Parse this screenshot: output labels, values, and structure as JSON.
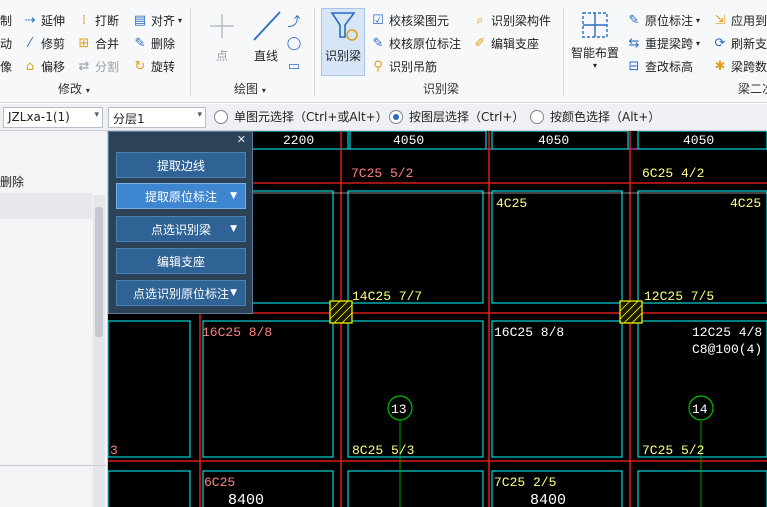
{
  "ribbon": {
    "modify": {
      "col1": [
        "制",
        "动",
        "像"
      ],
      "col2": [
        "延伸",
        "修剪",
        "偏移"
      ],
      "col3": [
        "打断",
        "合并",
        "分割"
      ],
      "col4": [
        "对齐",
        "删除",
        "旋转"
      ],
      "group_label": "修改"
    },
    "draw": {
      "point": "点",
      "line": "直线",
      "group_label": "绘图"
    },
    "identify_beam": {
      "big_button": "识别梁",
      "items": [
        "校核梁图元",
        "校核原位标注",
        "识别吊筋",
        "识别梁构件",
        "编辑支座"
      ],
      "group_label": "识别梁"
    },
    "beam2": {
      "smart_layout": "智能布置",
      "items": [
        "原位标注",
        "重提梁跨",
        "查改标高",
        "应用到",
        "刷新支",
        "梁跨数"
      ],
      "group_label": "梁二次"
    }
  },
  "filterbar": {
    "element_combo": "JZLxa-1(1)",
    "layer_combo": "分层1",
    "radio_single": "单图元选择（Ctrl+或Alt+）",
    "radio_layer": "按图层选择（Ctrl+）",
    "radio_color": "按颜色选择（Alt+）",
    "selected": "radio_layer"
  },
  "leftpanel": {
    "row_label": "删除"
  },
  "toolpanel": {
    "buttons": [
      "提取边线",
      "提取原位标注",
      "点选识别梁",
      "编辑支座",
      "点选识别原位标注"
    ]
  },
  "cad": {
    "top_dims": [
      "2200",
      "4050",
      "4050",
      "4050"
    ],
    "labels": {
      "a": "7C25 5/2",
      "b": "6C25 4/2",
      "c": "4C25",
      "d": "4C25",
      "e": "14C25 7/7",
      "f": "12C25 7/5",
      "g": "16C25 8/8",
      "h": "16C25 8/8",
      "i": "12C25 4/8",
      "j": "C8@100(4)",
      "k": "8C25 5/3",
      "l": "7C25 5/2",
      "m": "6C25",
      "n": "7C25 2/5",
      "o": "3"
    },
    "axis": [
      "13",
      "14"
    ],
    "bottom_dims": [
      "8400",
      "8400"
    ]
  },
  "colors": {
    "cad_bg": "#000000",
    "cyan": "#00ffff",
    "red": "#ff0000",
    "label": "#ff8080",
    "label_yellow": "#ffff80",
    "column": "#ffff00",
    "axis_green": "#00a000",
    "panel_blue": "#2f6395"
  }
}
